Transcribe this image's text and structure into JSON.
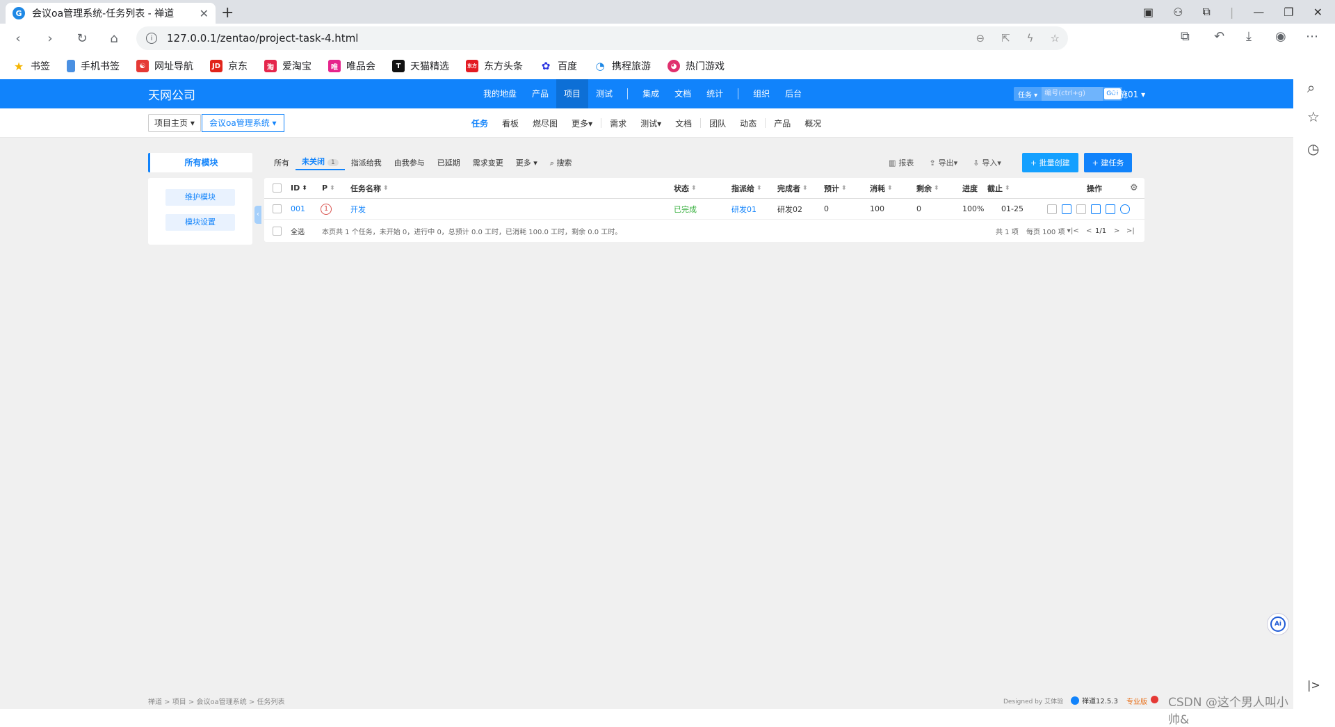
{
  "browser": {
    "tab_title": "会议oa管理系统-任务列表 - 禅道",
    "url": "127.0.0.1/zentao/project-task-4.html",
    "bookmarks": [
      {
        "label": "书签",
        "color": "#f5b400",
        "icon": "star-icon"
      },
      {
        "label": "手机书签",
        "color": "#4a90e2",
        "icon": "phone-icon"
      },
      {
        "label": "网址导航",
        "color": "#e53935",
        "icon": "nav-icon"
      },
      {
        "label": "京东",
        "color": "#e1251b",
        "icon": "jd-icon"
      },
      {
        "label": "爱淘宝",
        "color": "#e5264c",
        "icon": "taobao-icon"
      },
      {
        "label": "唯品会",
        "color": "#e6258c",
        "icon": "vip-icon"
      },
      {
        "label": "天猫精选",
        "color": "#d4001a",
        "icon": "tmall-icon"
      },
      {
        "label": "东方头条",
        "color": "#e31b23",
        "icon": "toutiao-icon"
      },
      {
        "label": "百度",
        "color": "#2932e1",
        "icon": "baidu-icon"
      },
      {
        "label": "携程旅游",
        "color": "#1e88e5",
        "icon": "ctrip-icon"
      },
      {
        "label": "热门游戏",
        "color": "#e0306e",
        "icon": "game-icon"
      }
    ]
  },
  "header": {
    "company": "天网公司",
    "nav": [
      "我的地盘",
      "产品",
      "项目",
      "测试",
      "集成",
      "文档",
      "统计",
      "组织",
      "后台"
    ],
    "active_nav": "项目",
    "search_type": "任务",
    "search_placeholder": "编号(ctrl+g)",
    "search_go": "GO!",
    "user": "实施01"
  },
  "subbar": {
    "crumb_home": "项目主页",
    "crumb_project": "会议oa管理系统",
    "nav": [
      "任务",
      "看板",
      "燃尽图",
      "更多",
      "需求",
      "测试",
      "文档",
      "团队",
      "动态",
      "产品",
      "概况"
    ]
  },
  "toolbar": {
    "module_label": "所有模块",
    "filters": [
      "所有",
      "未关闭",
      "指派给我",
      "由我参与",
      "已延期",
      "需求变更",
      "更多",
      "搜索"
    ],
    "unclosed_count": "1",
    "report": "报表",
    "export": "导出",
    "import": "导入",
    "batch_create": "+ 批量创建",
    "create_task": "+ 建任务"
  },
  "leftpanel": {
    "maintain": "维护模块",
    "settings": "模块设置"
  },
  "table": {
    "headers": {
      "id": "ID",
      "p": "P",
      "name": "任务名称",
      "status": "状态",
      "assigned": "指派给",
      "finished_by": "完成者",
      "estimate": "预计",
      "consumed": "消耗",
      "left": "剩余",
      "progress": "进度",
      "deadline": "截止",
      "actions": "操作"
    },
    "rows": [
      {
        "id": "001",
        "p": "1",
        "name": "开发",
        "status": "已完成",
        "assigned": "研发01",
        "finished_by": "研发02",
        "estimate": "0",
        "consumed": "100",
        "left": "0",
        "progress": "100%",
        "deadline": "01-25"
      }
    ],
    "footer": {
      "select_all": "全选",
      "summary": "本页共 1 个任务，未开始 0，进行中 0，总预计 0.0 工时，已消耗 100.0 工时，剩余 0.0 工时。",
      "total": "共 1 项",
      "per_page": "每页 100 项",
      "pager": "1/1"
    }
  },
  "footer": {
    "breadcrumb": "禅道 > 项目 > 会议oa管理系统 > 任务列表",
    "designed_by": "Designed by 艾体验",
    "version": "禅道12.5.3",
    "edition": "专业版",
    "watermark": "CSDN @这个男人叫小帅&"
  }
}
